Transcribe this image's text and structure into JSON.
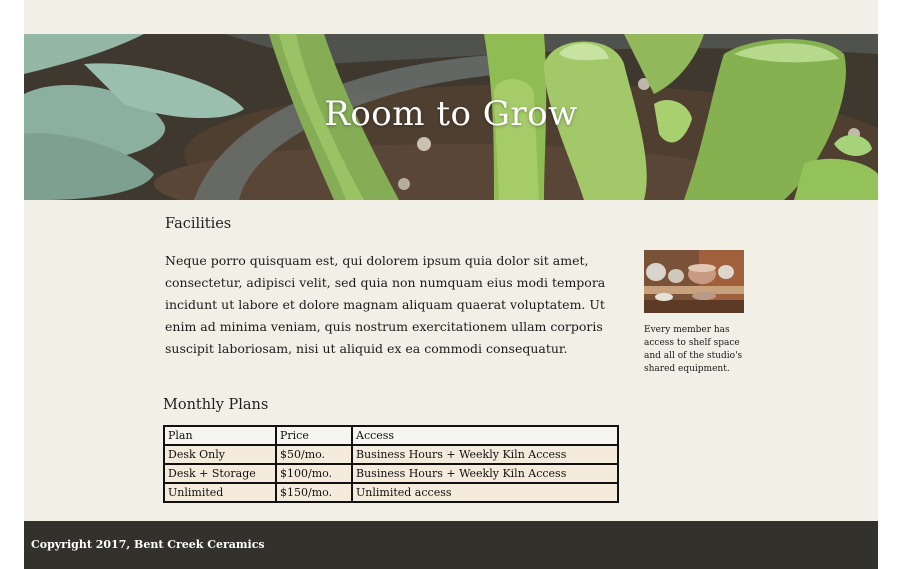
{
  "hero": {
    "title": "Room to Grow"
  },
  "facilities": {
    "title": "Facilities",
    "body": "Neque porro quisquam est, qui dolorem ipsum quia dolor sit amet, consectetur, adipisci velit, sed quia non numquam eius modi tempora incidunt ut labore et dolore magnam aliquam quaerat voluptatem. Ut enim ad minima veniam, quis nostrum exercitationem ullam corporis suscipit laboriosam, nisi ut aliquid ex ea commodi consequatur.",
    "caption": "Every member has access to shelf space and all of the studio's shared equipment."
  },
  "plans": {
    "title": "Monthly Plans",
    "headers": [
      "Plan",
      "Price",
      "Access"
    ],
    "rows": [
      [
        "Desk Only",
        "$50/mo.",
        "Business Hours + Weekly Kiln Access"
      ],
      [
        "Desk + Storage",
        "$100/mo.",
        "Business Hours + Weekly Kiln Access"
      ],
      [
        "Unlimited",
        "$150/mo.",
        "Unlimited access"
      ]
    ]
  },
  "footer": {
    "copyright": "Copyright 2017, Bent Creek Ceramics"
  },
  "colors": {
    "page_bg": "#f1efe6",
    "footer_bg": "#32312b",
    "table_row_bg": "#f4ebdd"
  }
}
